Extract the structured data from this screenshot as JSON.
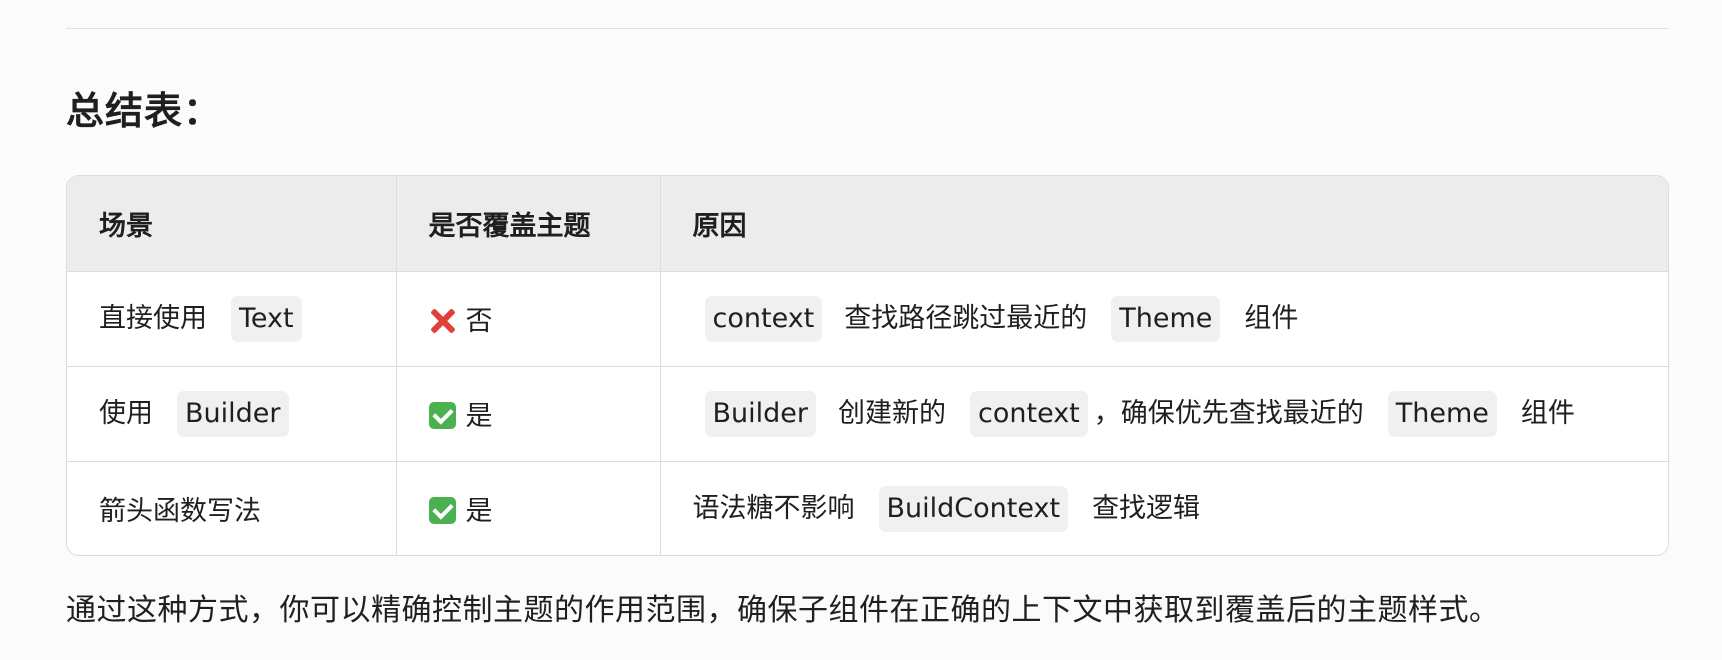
{
  "heading": "总结表：",
  "table": {
    "headers": [
      "场景",
      "是否覆盖主题",
      "原因"
    ],
    "rows": [
      {
        "scene": {
          "text": "直接使用",
          "code": "Text"
        },
        "override": {
          "icon": "cross-mark-icon",
          "text": "否"
        },
        "reason": {
          "code1": "context",
          "text1": "查找路径跳过最近的",
          "code2": "Theme",
          "text2": "组件"
        }
      },
      {
        "scene": {
          "text": "使用",
          "code": "Builder"
        },
        "override": {
          "icon": "check-mark-icon",
          "text": "是"
        },
        "reason": {
          "code1": "Builder",
          "text1": "创建新的",
          "code2": "context",
          "text2": "，确保优先查找最近的",
          "code3": "Theme",
          "text3": "组件"
        }
      },
      {
        "scene": {
          "text": "箭头函数写法"
        },
        "override": {
          "icon": "check-mark-icon",
          "text": "是"
        },
        "reason": {
          "text1": "语法糖不影响",
          "code1": "BuildContext",
          "text2": "查找逻辑"
        }
      }
    ]
  },
  "footer": "通过这种方式，你可以精确控制主题的作用范围，确保子组件在正确的上下文中获取到覆盖后的主题样式。",
  "colors": {
    "cross": "#e0403a",
    "check": "#4bb04f",
    "header_bg": "#ececec",
    "code_bg": "#f0f0f0"
  }
}
